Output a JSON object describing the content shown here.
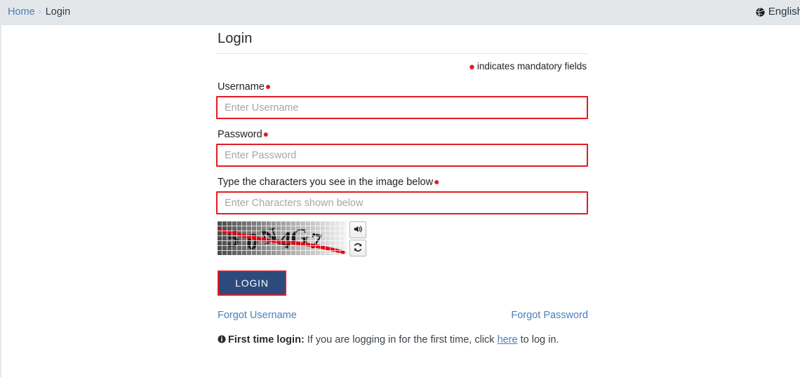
{
  "topbar": {
    "breadcrumb": {
      "home_label": "Home",
      "separator": "›",
      "current_label": "Login"
    },
    "language": {
      "label": "English",
      "icon": "globe-icon"
    }
  },
  "form": {
    "title": "Login",
    "mandatory_note": {
      "dot": "●",
      "text": "indicates mandatory fields"
    },
    "username": {
      "label": "Username",
      "value": "",
      "placeholder": "Enter Username"
    },
    "password": {
      "label": "Password",
      "value": "",
      "placeholder": "Enter Password"
    },
    "captcha": {
      "label": "Type the characters you see in the image below",
      "value": "",
      "placeholder": "Enter Characters shown below",
      "audio_button_icon": "speaker-icon",
      "refresh_button_icon": "refresh-icon"
    },
    "submit": {
      "label": "LOGIN"
    },
    "links": {
      "forgot_username": "Forgot Username",
      "forgot_password": "Forgot Password"
    },
    "first_time": {
      "icon": "info-icon",
      "heading": "First time login:",
      "text_before": " If you are logging in for the first time, click ",
      "link": "here",
      "text_after": " to log in."
    }
  },
  "colors": {
    "topbar_bg": "#e3e7ea",
    "link_blue": "#4a7ebb",
    "required_red": "#e31b23",
    "button_navy": "#2c4b7c",
    "page_bg": "#ffffff"
  }
}
